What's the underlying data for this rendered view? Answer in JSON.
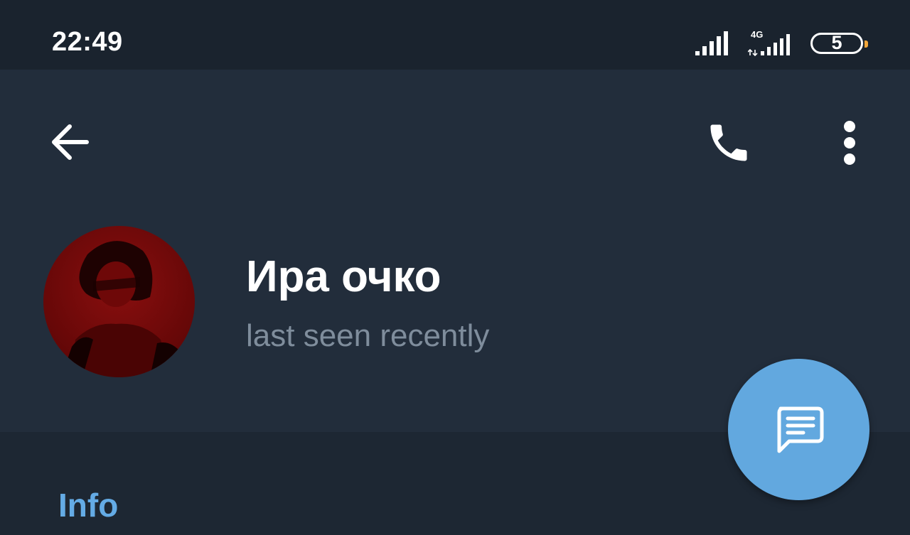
{
  "status_bar": {
    "time": "22:49",
    "network_label": "4G",
    "battery_level": "5",
    "icons": [
      "signal-icon",
      "signal-4g-icon",
      "battery-icon"
    ]
  },
  "toolbar": {
    "back_icon": "arrow-left-icon",
    "call_icon": "phone-icon",
    "menu_icon": "more-vertical-icon"
  },
  "profile": {
    "name": "Ира очко",
    "status": "last seen recently"
  },
  "info": {
    "title": "Info"
  },
  "fab": {
    "icon": "message-icon"
  },
  "colors": {
    "status_bar_bg": "#1a232e",
    "header_bg": "#222d3b",
    "body_bg": "#1d2733",
    "accent": "#62a8df",
    "status_text": "#7f8d9c",
    "battery_tip": "#f2a63a"
  }
}
